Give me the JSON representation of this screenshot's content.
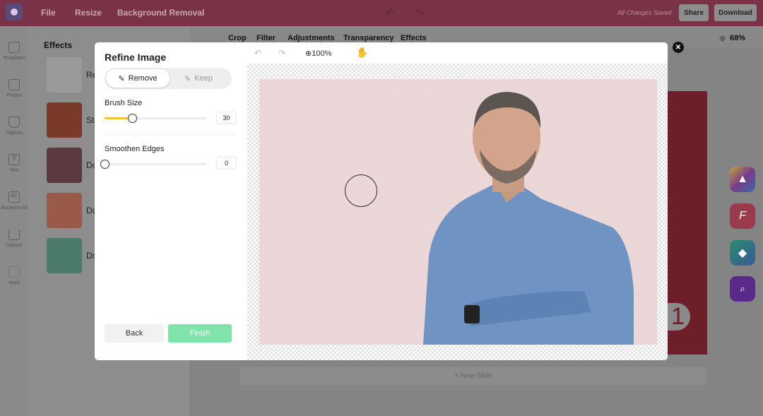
{
  "topbar": {
    "menu": [
      "File",
      "Resize",
      "Background Removal"
    ],
    "status": "All Changes Saved",
    "share": "Share",
    "download": "Download"
  },
  "sidebar": {
    "items": [
      "Templates",
      "Photos",
      "Objects",
      "Text",
      "Background",
      "Upload",
      "Apps"
    ],
    "bg_badge": "BG"
  },
  "effects_panel": {
    "title": "Effects",
    "items": [
      "Re",
      "St",
      "Do",
      "Du",
      "Dr"
    ]
  },
  "subbar": {
    "items": [
      "Crop",
      "Filter",
      "Adjustments",
      "Transparency",
      "Effects"
    ],
    "zoom": "68%"
  },
  "new_slide": "+ New Slide",
  "canvas": {
    "page_number": "1"
  },
  "modal": {
    "title": "Refine Image",
    "modes": [
      {
        "label": "Remove",
        "active": true
      },
      {
        "label": "Keep",
        "active": false
      }
    ],
    "brush_size": {
      "label": "Brush Size",
      "value": "30",
      "fraction": 0.27
    },
    "smoothen": {
      "label": "Smoothen Edges",
      "value": "0",
      "fraction": 0
    },
    "zoom": "100%",
    "back": "Back",
    "finish": "Finish",
    "colors": {
      "finish": "#7fe3aa",
      "slider": "#f2c230"
    }
  }
}
